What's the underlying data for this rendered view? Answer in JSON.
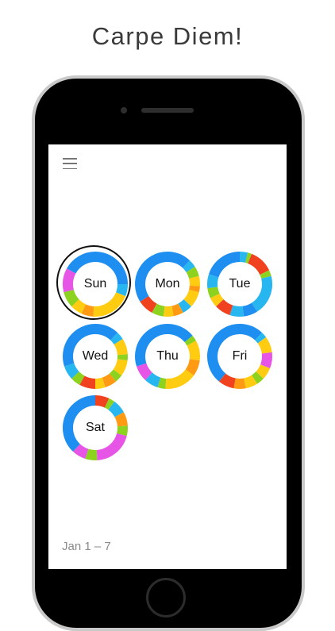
{
  "headline": "Carpe Diem!",
  "date_range": "Jan 1 – 7",
  "colors": {
    "blue": "#1e8ff0",
    "light_blue": "#27b6f0",
    "yellow": "#ffcc12",
    "orange": "#ff9a12",
    "red": "#f0421f",
    "green": "#8cd21e",
    "pink": "#e655e6",
    "magenta": "#d24ae6"
  },
  "days": [
    {
      "label": "Sun",
      "selected": true,
      "segments": [
        [
          "blue",
          0.25
        ],
        [
          "light_blue",
          0.06
        ],
        [
          "yellow",
          0.2
        ],
        [
          "orange",
          0.06
        ],
        [
          "yellow",
          0.06
        ],
        [
          "green",
          0.08
        ],
        [
          "pink",
          0.12
        ],
        [
          "blue",
          0.17
        ]
      ]
    },
    {
      "label": "Mon",
      "selected": false,
      "segments": [
        [
          "blue",
          0.12
        ],
        [
          "light_blue",
          0.04
        ],
        [
          "green",
          0.05
        ],
        [
          "yellow",
          0.05
        ],
        [
          "orange",
          0.03
        ],
        [
          "yellow",
          0.08
        ],
        [
          "light_blue",
          0.05
        ],
        [
          "orange",
          0.05
        ],
        [
          "yellow",
          0.05
        ],
        [
          "green",
          0.06
        ],
        [
          "red",
          0.08
        ],
        [
          "blue",
          0.34
        ]
      ]
    },
    {
      "label": "Tue",
      "selected": false,
      "segments": [
        [
          "light_blue",
          0.04
        ],
        [
          "green",
          0.02
        ],
        [
          "red",
          0.12
        ],
        [
          "green",
          0.03
        ],
        [
          "light_blue",
          0.2
        ],
        [
          "blue",
          0.07
        ],
        [
          "light_blue",
          0.07
        ],
        [
          "red",
          0.08
        ],
        [
          "yellow",
          0.05
        ],
        [
          "green",
          0.05
        ],
        [
          "light_blue",
          0.07
        ],
        [
          "blue",
          0.2
        ]
      ]
    },
    {
      "label": "Wed",
      "selected": false,
      "segments": [
        [
          "blue",
          0.12
        ],
        [
          "light_blue",
          0.04
        ],
        [
          "yellow",
          0.08
        ],
        [
          "green",
          0.03
        ],
        [
          "yellow",
          0.08
        ],
        [
          "green",
          0.04
        ],
        [
          "orange",
          0.06
        ],
        [
          "yellow",
          0.05
        ],
        [
          "red",
          0.08
        ],
        [
          "green",
          0.05
        ],
        [
          "light_blue",
          0.07
        ],
        [
          "blue",
          0.3
        ]
      ]
    },
    {
      "label": "Thu",
      "selected": false,
      "segments": [
        [
          "blue",
          0.14
        ],
        [
          "green",
          0.03
        ],
        [
          "yellow",
          0.1
        ],
        [
          "orange",
          0.08
        ],
        [
          "yellow",
          0.16
        ],
        [
          "green",
          0.04
        ],
        [
          "light_blue",
          0.07
        ],
        [
          "pink",
          0.08
        ],
        [
          "blue",
          0.3
        ]
      ]
    },
    {
      "label": "Fri",
      "selected": false,
      "segments": [
        [
          "blue",
          0.12
        ],
        [
          "light_blue",
          0.03
        ],
        [
          "yellow",
          0.08
        ],
        [
          "pink",
          0.08
        ],
        [
          "yellow",
          0.06
        ],
        [
          "green",
          0.04
        ],
        [
          "yellow",
          0.06
        ],
        [
          "orange",
          0.06
        ],
        [
          "red",
          0.08
        ],
        [
          "blue",
          0.39
        ]
      ]
    },
    {
      "label": "Sat",
      "selected": false,
      "segments": [
        [
          "red",
          0.07
        ],
        [
          "green",
          0.03
        ],
        [
          "light_blue",
          0.07
        ],
        [
          "orange",
          0.07
        ],
        [
          "green",
          0.05
        ],
        [
          "pink",
          0.2
        ],
        [
          "green",
          0.06
        ],
        [
          "pink",
          0.07
        ],
        [
          "blue",
          0.38
        ]
      ]
    }
  ]
}
